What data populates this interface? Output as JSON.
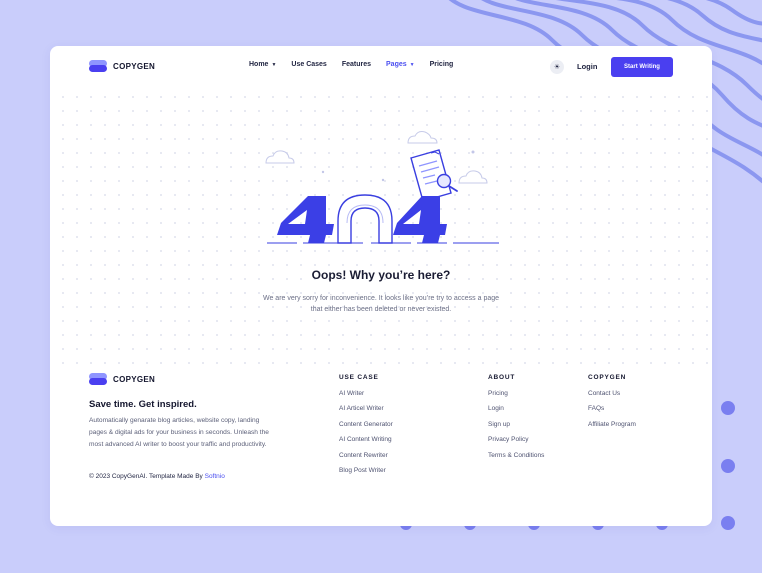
{
  "header": {
    "logo_text": "COPYGEN",
    "nav": [
      {
        "label": "Home",
        "has_dropdown": true,
        "active": false
      },
      {
        "label": "Use Cases",
        "has_dropdown": false,
        "active": false
      },
      {
        "label": "Features",
        "has_dropdown": false,
        "active": false
      },
      {
        "label": "Pages",
        "has_dropdown": true,
        "active": true
      },
      {
        "label": "Pricing",
        "has_dropdown": false,
        "active": false
      }
    ],
    "theme_icon": "sun-icon",
    "login_label": "Login",
    "cta_label": "Start Writing"
  },
  "error": {
    "code_text": "404",
    "title": "Oops! Why you’re here?",
    "message": "We are very sorry for inconvenience. It looks like you’re try to access a page that either has been deleted or never existed."
  },
  "footer": {
    "logo_text": "COPYGEN",
    "tagline": "Save time. Get inspired.",
    "description": "Automatically genarate blog articles, website copy, landing pages & digital ads for your business in seconds. Unleash the most advanced AI writer to boost your traffic and productivity.",
    "copyright_prefix": "© 2023 CopyGenAI. Template Made By ",
    "copyright_link": "Softnio",
    "columns": [
      {
        "title": "USE CASE",
        "links": [
          "AI Writer",
          "AI Articel Writer",
          "Content Generator",
          "AI Content Writing",
          "Content Rewriter",
          "Blog Post Writer"
        ]
      },
      {
        "title": "ABOUT",
        "links": [
          "Pricing",
          "Login",
          "Sign up",
          "Privacy Policy",
          "Terms & Conditions"
        ]
      },
      {
        "title": "COPYGEN",
        "links": [
          "Contact Us",
          "FAQs",
          "Affiliate Program"
        ]
      }
    ]
  },
  "colors": {
    "accent": "#4a3ff0",
    "background": "#c9cdfb",
    "card": "#ffffff"
  }
}
